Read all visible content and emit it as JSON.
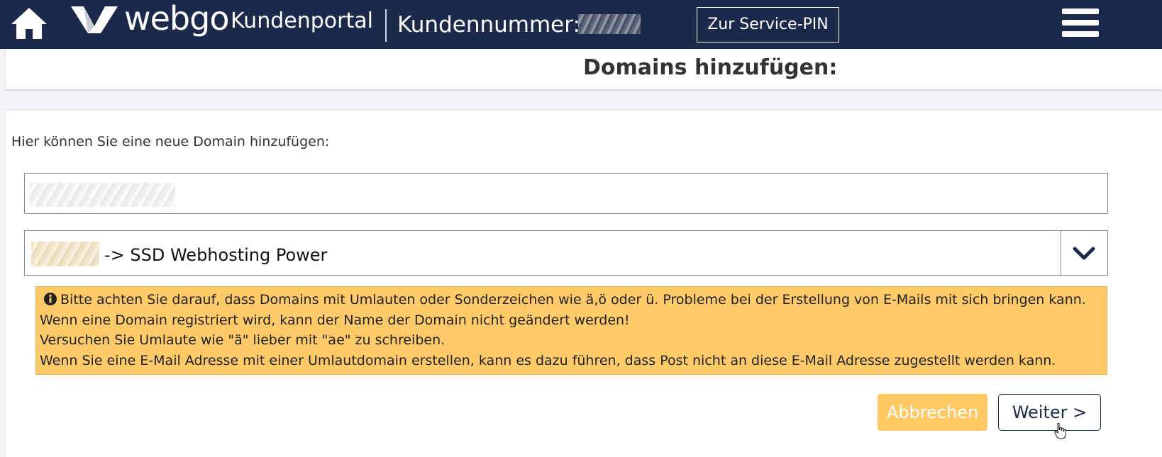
{
  "header": {
    "brand": "webgo",
    "portal": "Kundenportal",
    "customer_label": "Kundennummer: 4",
    "service_pin_button": "Zur Service-PIN",
    "icons": {
      "home": "home-icon",
      "logo": "webgo-logo-icon",
      "menu": "hamburger-menu-icon"
    }
  },
  "page": {
    "title": "Domains hinzufügen:"
  },
  "form": {
    "intro": "Hier können Sie eine neue Domain hinzufügen:",
    "domain_input_value": "",
    "package_select_value": "-> SSD Webhosting Power"
  },
  "notice": {
    "lines": [
      "Bitte achten Sie darauf, dass Domains mit Umlauten oder Sonderzeichen wie ä,ö oder ü. Probleme bei der Erstellung von E-Mails mit sich bringen kann.",
      "Wenn eine Domain registriert wird, kann der Name der Domain nicht geändert werden!",
      "Versuchen Sie Umlaute wie \"ä\" lieber mit \"ae\" zu schreiben.",
      "Wenn Sie eine E-Mail Adresse mit einer Umlautdomain erstellen, kann es dazu führen, dass Post nicht an diese E-Mail Adresse zugestellt werden kann."
    ]
  },
  "actions": {
    "cancel": "Abbrechen",
    "next": "Weiter >"
  },
  "colors": {
    "header_bg": "#1b2a4a",
    "notice_bg": "#ffcb69",
    "cancel_bg": "#ffca64"
  }
}
